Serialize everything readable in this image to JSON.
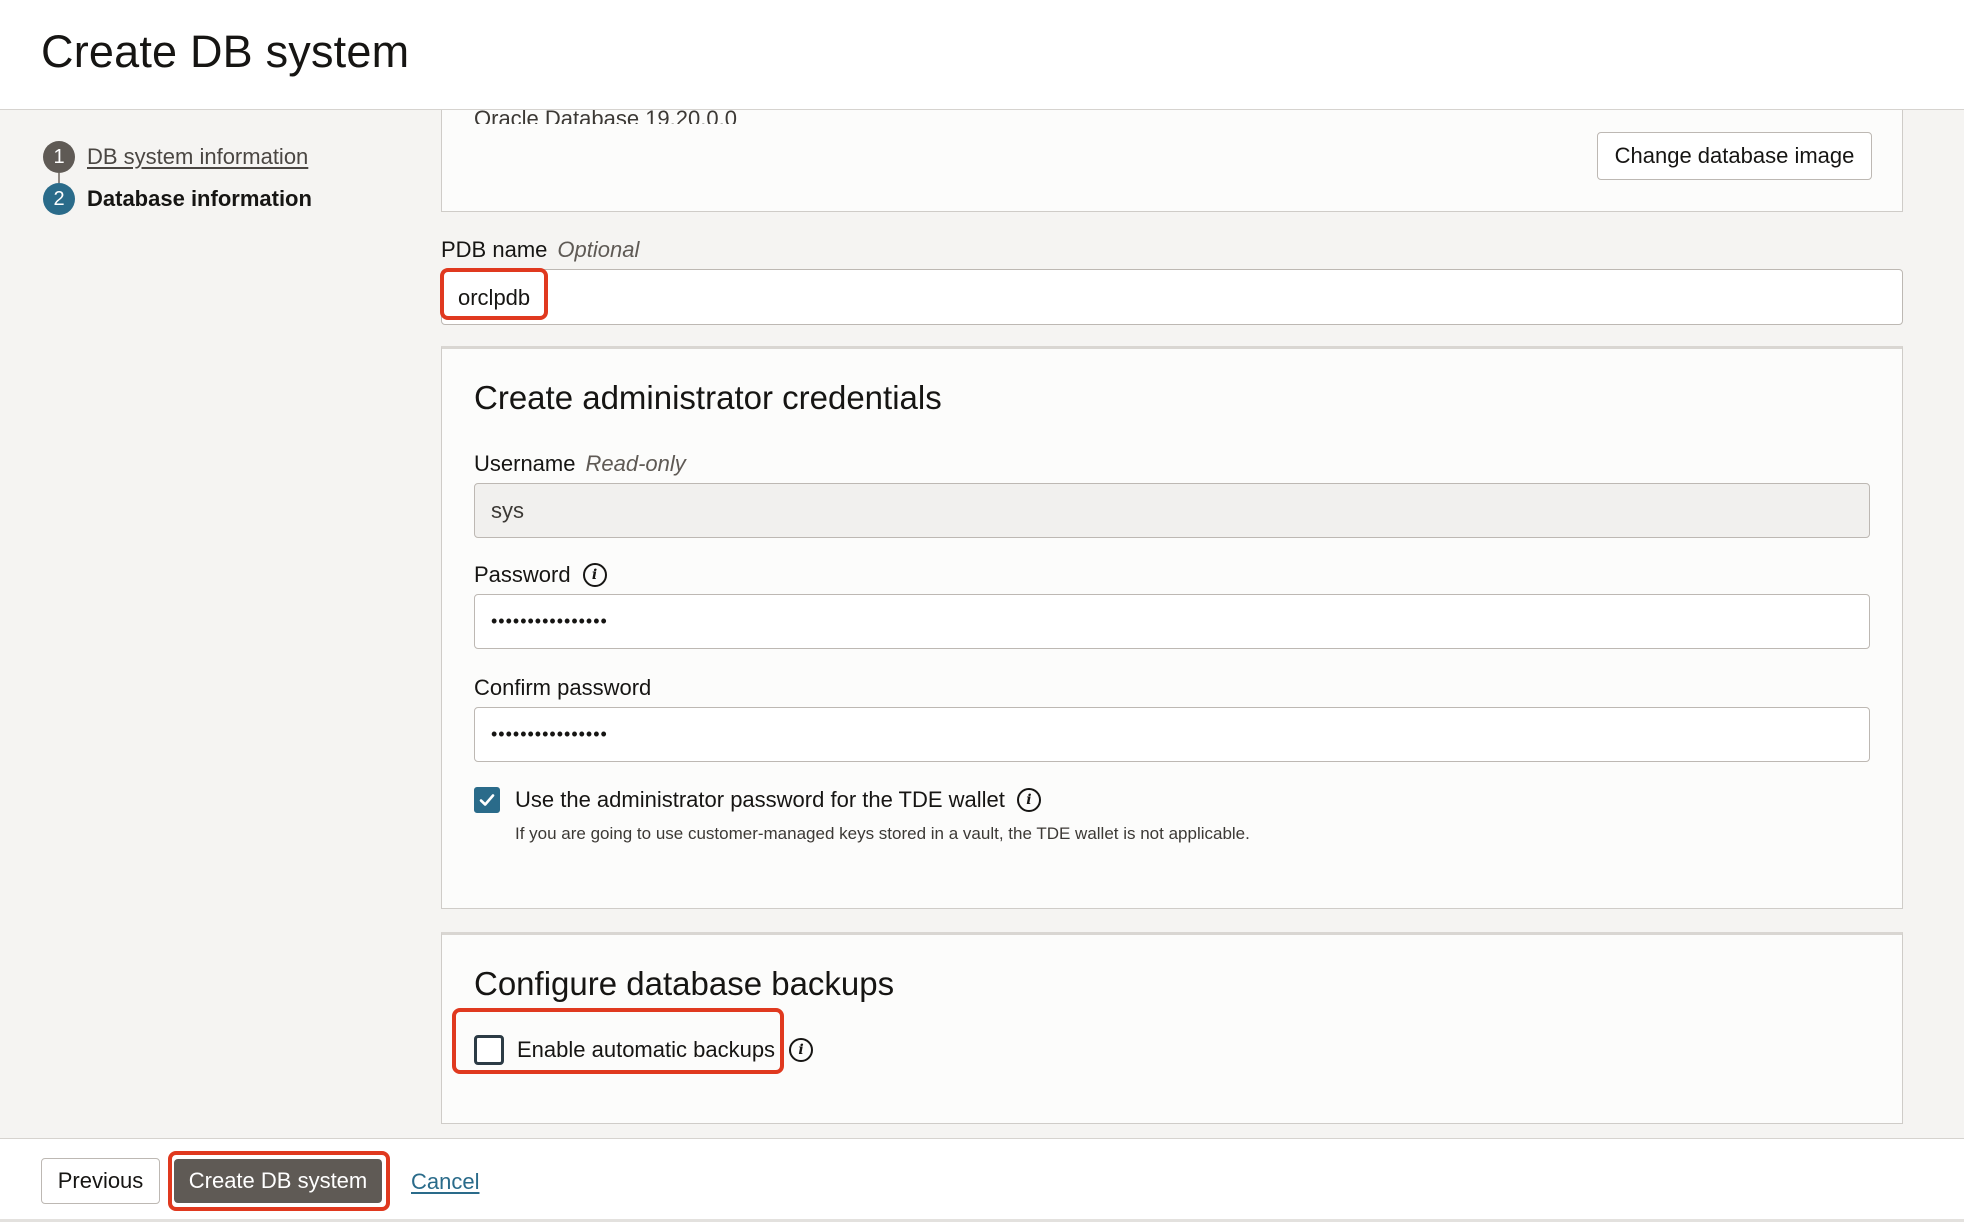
{
  "header": {
    "title": "Create DB system"
  },
  "wizard": {
    "steps": [
      {
        "number": "1",
        "label": "DB system information"
      },
      {
        "number": "2",
        "label": "Database information"
      }
    ]
  },
  "image_section": {
    "current_image": "Oracle Database 19.20.0.0",
    "change_button": "Change database image"
  },
  "pdb": {
    "label": "PDB name",
    "hint": "Optional",
    "value": "orclpdb"
  },
  "admin": {
    "title": "Create administrator credentials",
    "username_label": "Username",
    "username_hint": "Read-only",
    "username_value": "sys",
    "password_label": "Password",
    "password_value": "••••••••••••••••",
    "confirm_label": "Confirm password",
    "confirm_value": "••••••••••••••••",
    "tde_label": "Use the administrator password for the TDE wallet",
    "tde_checked": true,
    "tde_helper": "If you are going to use customer-managed keys stored in a vault, the TDE wallet is not applicable."
  },
  "backups": {
    "title": "Configure database backups",
    "enable_label": "Enable automatic backups",
    "enable_checked": false
  },
  "footer": {
    "previous": "Previous",
    "create": "Create DB system",
    "cancel": "Cancel"
  },
  "colors": {
    "accent": "#2a6b8a",
    "primary_button": "#5f5a55",
    "highlight": "#e0391f"
  },
  "icons": {
    "info": "info-icon",
    "check": "checkmark-icon"
  }
}
